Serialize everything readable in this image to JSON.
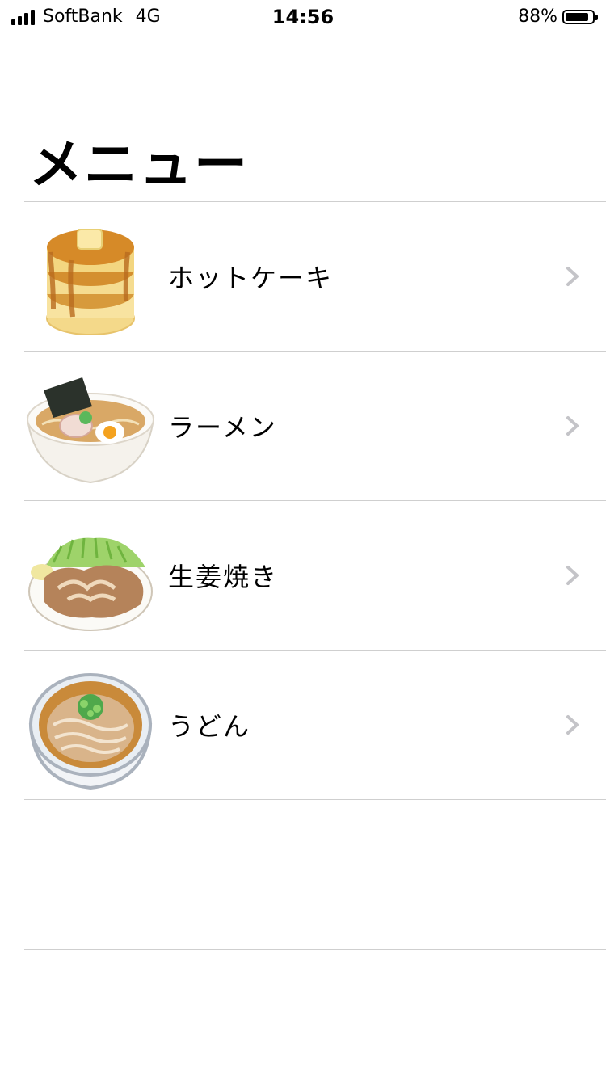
{
  "status": {
    "carrier": "SoftBank",
    "network": "4G",
    "time": "14:56",
    "battery_percent": "88%",
    "battery_level": 0.88
  },
  "page": {
    "title": "メニュー"
  },
  "menu": {
    "items": [
      {
        "label": "ホットケーキ",
        "icon": "pancake-icon"
      },
      {
        "label": "ラーメン",
        "icon": "ramen-icon"
      },
      {
        "label": "生姜焼き",
        "icon": "ginger-pork-icon"
      },
      {
        "label": "うどん",
        "icon": "udon-icon"
      }
    ]
  },
  "colors": {
    "divider": "#cfcfcf",
    "chevron": "#c4c4c8"
  }
}
